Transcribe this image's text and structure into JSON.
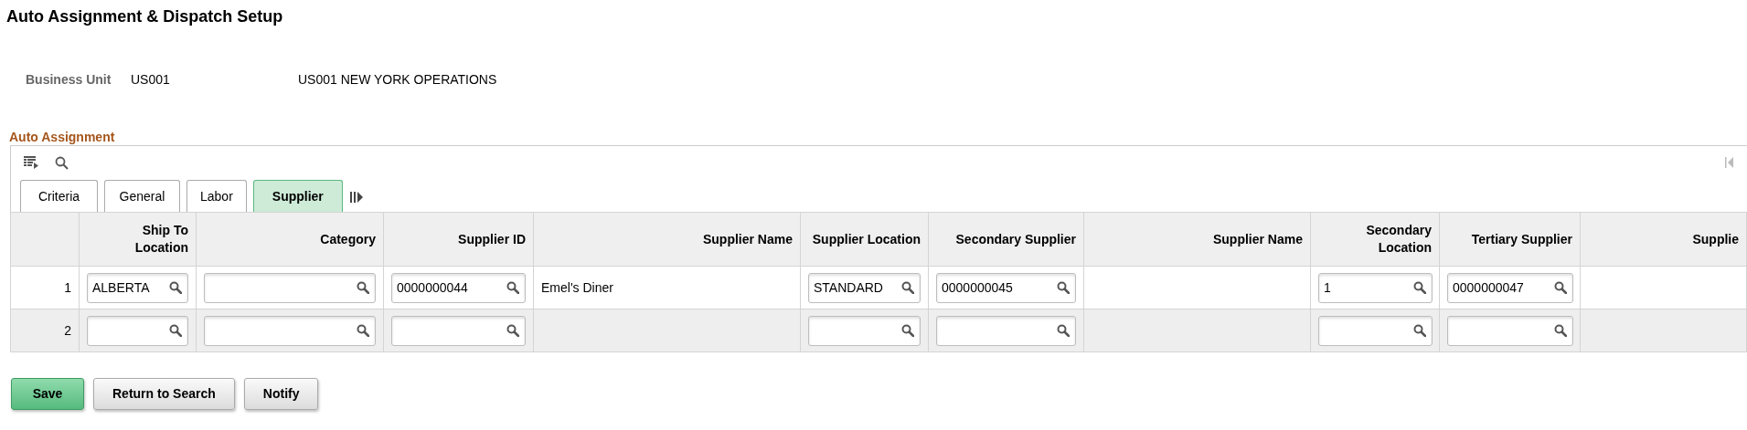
{
  "page_title": "Auto Assignment & Dispatch Setup",
  "business_unit": {
    "label": "Business Unit",
    "value": "US001",
    "description": "US001 NEW YORK OPERATIONS"
  },
  "section_title": "Auto Assignment",
  "tabs": [
    {
      "label": "Criteria",
      "selected": false
    },
    {
      "label": "General",
      "selected": false
    },
    {
      "label": "Labor",
      "selected": false
    },
    {
      "label": "Supplier",
      "selected": true
    }
  ],
  "table": {
    "columns": [
      "",
      "Ship To Location",
      "Category",
      "Supplier ID",
      "Supplier Name",
      "Supplier Location",
      "Secondary Supplier",
      "Supplier Name",
      "Secondary Location",
      "Tertiary Supplier",
      "Supplie"
    ],
    "rows": [
      {
        "cells": [
          {
            "kind": "number",
            "value": "1"
          },
          {
            "kind": "lookup",
            "value": "ALBERTA"
          },
          {
            "kind": "lookup"
          },
          {
            "kind": "lookup",
            "value": "0000000044"
          },
          {
            "kind": "text",
            "value": "Emel's Diner"
          },
          {
            "kind": "lookup",
            "value": "STANDARD"
          },
          {
            "kind": "lookup",
            "value": "0000000045"
          },
          {
            "kind": "text"
          },
          {
            "kind": "lookup",
            "value": "1"
          },
          {
            "kind": "lookup",
            "value": "0000000047"
          },
          {
            "kind": "text"
          }
        ]
      },
      {
        "cells": [
          {
            "kind": "number",
            "value": "2"
          },
          {
            "kind": "lookup"
          },
          {
            "kind": "lookup"
          },
          {
            "kind": "lookup"
          },
          {
            "kind": "text"
          },
          {
            "kind": "lookup"
          },
          {
            "kind": "lookup"
          },
          {
            "kind": "text"
          },
          {
            "kind": "lookup"
          },
          {
            "kind": "lookup"
          },
          {
            "kind": "text"
          }
        ]
      }
    ]
  },
  "buttons": [
    {
      "label": "Save",
      "kind": "primary"
    },
    {
      "label": "Return to Search",
      "kind": "secondary"
    },
    {
      "label": "Notify",
      "kind": "secondary"
    }
  ]
}
